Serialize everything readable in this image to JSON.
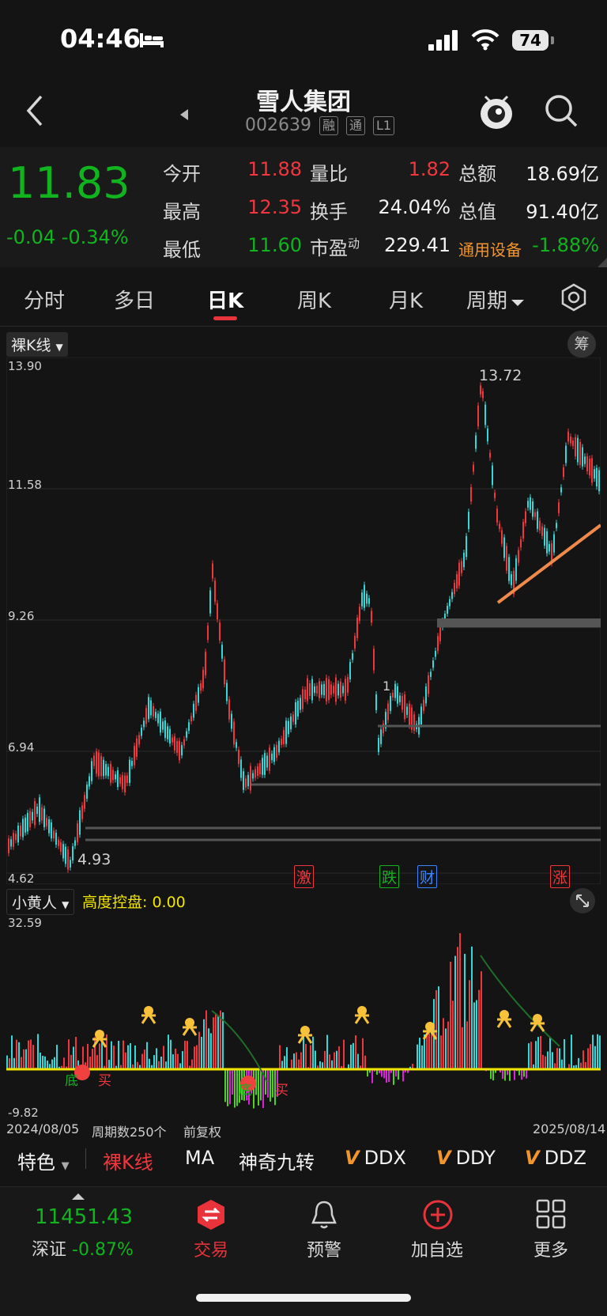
{
  "status_bar": {
    "time": "04:46",
    "battery": "74"
  },
  "header": {
    "stock_name": "雪人集团",
    "stock_code": "002639",
    "tags": [
      "融",
      "通",
      "L1"
    ]
  },
  "quote": {
    "price": "11.83",
    "change": "-0.04  -0.34%",
    "rows": [
      [
        {
          "label": "今开",
          "value": "11.88",
          "color": "red"
        },
        {
          "label": "量比",
          "value": "1.82",
          "color": "red"
        },
        {
          "label": "总额",
          "value": "18.69亿",
          "color": "white"
        }
      ],
      [
        {
          "label": "最高",
          "value": "12.35",
          "color": "red"
        },
        {
          "label": "换手",
          "value": "24.04%",
          "color": "white"
        },
        {
          "label": "总值",
          "value": "91.40亿",
          "color": "white"
        }
      ],
      [
        {
          "label": "最低",
          "value": "11.60",
          "color": "green"
        },
        {
          "label": "市盈",
          "sup": "动",
          "value": "229.41",
          "color": "white"
        },
        {
          "label": "通用设备",
          "value": "-1.88%",
          "color": "green",
          "label_color": "orange"
        }
      ]
    ]
  },
  "tabs": [
    {
      "label": "分时"
    },
    {
      "label": "多日"
    },
    {
      "label": "日K",
      "active": true
    },
    {
      "label": "周K"
    },
    {
      "label": "月K"
    },
    {
      "label": "周期"
    }
  ],
  "main_chart": {
    "mode_label": "裸K线",
    "chip_label": "筹",
    "y_ticks": [
      "13.90",
      "11.58",
      "9.26",
      "6.94",
      "4.62"
    ],
    "high_label": "13.72",
    "low_label": "4.93",
    "markers": [
      {
        "text": "激",
        "color": "#f0373e"
      },
      {
        "text": "跌",
        "color": "#11b31f"
      },
      {
        "text": "财",
        "color": "#3b86ff"
      },
      {
        "text": "涨",
        "color": "#f0373e"
      }
    ],
    "inner_mark": "1"
  },
  "indicator": {
    "name": "小黄人",
    "value_label": "高度控盘: 0.00",
    "y_max": "32.59",
    "y_min": "-9.82",
    "labels": [
      "底",
      "买",
      "底",
      "买"
    ]
  },
  "chart_footer": {
    "start_date": "2024/08/05",
    "period_count": "周期数250个",
    "adjust": "前复权",
    "end_date": "2025/08/14"
  },
  "indicator_tabs": {
    "first": "特色",
    "items": [
      {
        "label": "裸K线",
        "color": "#f0373e"
      },
      {
        "label": "MA"
      },
      {
        "label": "神奇九转"
      },
      {
        "label": "DDX",
        "v": true
      },
      {
        "label": "DDY",
        "v": true
      },
      {
        "label": "DDZ",
        "v": true
      }
    ]
  },
  "bottom_nav": {
    "index_value": "11451.43",
    "index_name": "深证",
    "index_change": "-0.87%",
    "items": [
      {
        "label": "交易"
      },
      {
        "label": "预警"
      },
      {
        "label": "加自选"
      },
      {
        "label": "更多"
      }
    ]
  }
}
